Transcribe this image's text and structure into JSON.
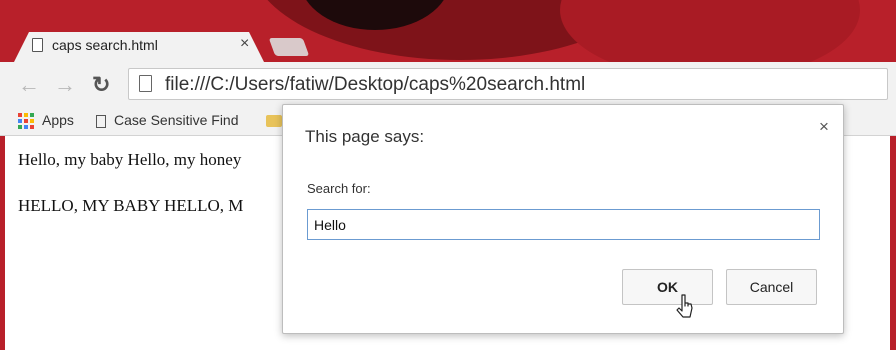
{
  "browser": {
    "tab": {
      "title": "caps search.html",
      "close_glyph": "×"
    },
    "toolbar": {
      "url": "file:///C:/Users/fatiw/Desktop/caps%20search.html"
    },
    "bookmarks": {
      "apps": "Apps",
      "case_sensitive_find": "Case Sensitive Find"
    },
    "colors": {
      "frame": "#b8202a",
      "input_border": "#6b9bd1"
    }
  },
  "page": {
    "line1": "Hello, my baby Hello, my honey",
    "line2": "HELLO, MY BABY HELLO, M"
  },
  "dialog": {
    "title": "This page says:",
    "close_glyph": "×",
    "label": "Search for:",
    "input_value": "Hello",
    "ok_label": "OK",
    "cancel_label": "Cancel"
  },
  "icons": {
    "back": "back-arrow-icon",
    "forward": "forward-arrow-icon",
    "reload": "reload-icon",
    "page": "page-icon",
    "apps": "apps-grid-icon",
    "folder": "folder-icon",
    "cursor": "mouse-cursor-icon"
  }
}
